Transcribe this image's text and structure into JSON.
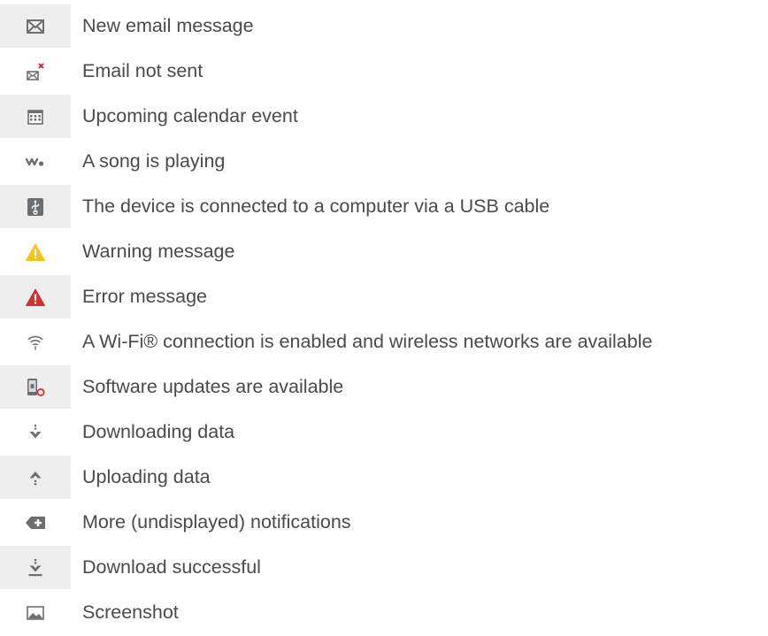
{
  "rows": [
    {
      "icon": "envelope-icon",
      "label": "New email message"
    },
    {
      "icon": "email-not-sent-icon",
      "label": "Email not sent"
    },
    {
      "icon": "calendar-icon",
      "label": "Upcoming calendar event"
    },
    {
      "icon": "walkman-icon",
      "label": "A song is playing"
    },
    {
      "icon": "usb-icon",
      "label": "The device is connected to a computer via a USB cable"
    },
    {
      "icon": "warning-icon",
      "label": "Warning message"
    },
    {
      "icon": "error-icon",
      "label": "Error message"
    },
    {
      "icon": "wifi-icon",
      "label": "A Wi-Fi® connection is enabled and wireless networks are available"
    },
    {
      "icon": "software-update-icon",
      "label": "Software updates are available"
    },
    {
      "icon": "download-icon",
      "label": "Downloading data"
    },
    {
      "icon": "upload-icon",
      "label": "Uploading data"
    },
    {
      "icon": "more-notifications-icon",
      "label": "More (undisplayed) notifications"
    },
    {
      "icon": "download-successful-icon",
      "label": "Download successful"
    },
    {
      "icon": "screenshot-icon",
      "label": "Screenshot"
    }
  ],
  "colors": {
    "icon_cell_bg": "#eeeeef",
    "icon_grey": "#6d6e71",
    "warning_yellow": "#f7c21a",
    "error_red": "#d0312d",
    "text": "#4a4a4c"
  }
}
